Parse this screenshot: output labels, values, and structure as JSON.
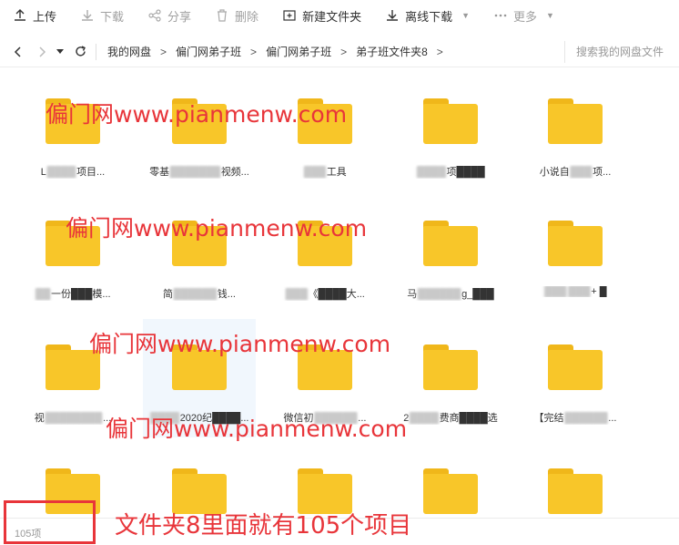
{
  "toolbar": {
    "upload": "上传",
    "download": "下载",
    "share": "分享",
    "delete": "删除",
    "new_folder": "新建文件夹",
    "offline_download": "离线下载",
    "more": "更多"
  },
  "nav": {
    "breadcrumbs": [
      "我的网盘",
      "偏门网弟子班",
      "偏门网弟子班",
      "弟子班文件夹8"
    ],
    "separator": ">",
    "search_placeholder": "搜索我的网盘文件"
  },
  "folders": [
    {
      "pre": "L",
      "blur": "████",
      "post": "项目..."
    },
    {
      "pre": "零基",
      "blur": "███████",
      "post": "视频..."
    },
    {
      "pre": "",
      "blur": "███",
      "post": "工具"
    },
    {
      "pre": "",
      "blur": "████",
      "post": "项████"
    },
    {
      "pre": "小说自",
      "blur": "███",
      "post": "项..."
    },
    {
      "pre": "",
      "blur": "██",
      "post": "一份███模..."
    },
    {
      "pre": "简",
      "blur": "██████",
      "post": "钱..."
    },
    {
      "pre": "",
      "blur": "███",
      "post": "《████大..."
    },
    {
      "pre": "马",
      "blur": "██████",
      "post": "g_███"
    },
    {
      "pre": "",
      "blur": "███  ███",
      "post": "+ █"
    },
    {
      "pre": "视",
      "blur": "████████",
      "post": "..."
    },
    {
      "pre": "",
      "blur": "████",
      "post": "2020纪████..."
    },
    {
      "pre": "微信初",
      "blur": "██████",
      "post": "..."
    },
    {
      "pre": "2",
      "blur": "████",
      "post": "费商████选"
    },
    {
      "pre": "【完结",
      "blur": "██████",
      "post": "..."
    },
    {
      "pre": "",
      "blur": "",
      "post": ""
    },
    {
      "pre": "",
      "blur": "",
      "post": ""
    },
    {
      "pre": "",
      "blur": "",
      "post": ""
    },
    {
      "pre": "",
      "blur": "",
      "post": ""
    },
    {
      "pre": "",
      "blur": "",
      "post": ""
    }
  ],
  "watermark": "偏门网www.pianmenw.com",
  "footer": {
    "item_count": "105项"
  },
  "annotation": "文件夹8里面就有105个项目",
  "colors": {
    "folder": "#f8c629",
    "folder_tab": "#f0b71a",
    "watermark": "#e8353a",
    "selected_bg": "#f1f7fd"
  }
}
